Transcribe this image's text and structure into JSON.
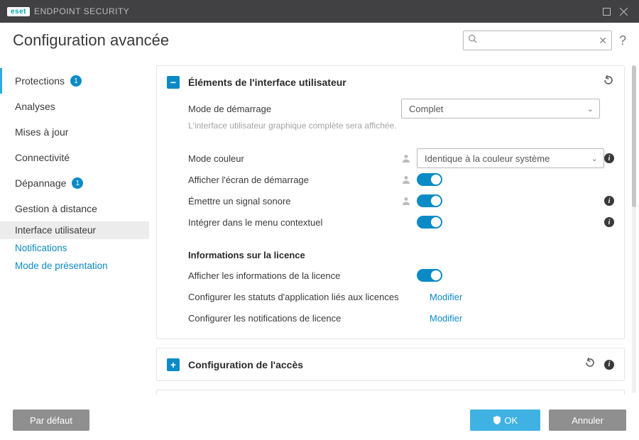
{
  "titlebar": {
    "brand": "eset",
    "product": "ENDPOINT SECURITY"
  },
  "header": {
    "title": "Configuration avancée",
    "search_placeholder": ""
  },
  "sidebar": {
    "items": [
      {
        "label": "Protections",
        "badge": "1"
      },
      {
        "label": "Analyses"
      },
      {
        "label": "Mises à jour"
      },
      {
        "label": "Connectivité"
      },
      {
        "label": "Dépannage",
        "badge": "1"
      },
      {
        "label": "Gestion à distance"
      }
    ],
    "sub": [
      {
        "label": "Interface utilisateur"
      },
      {
        "label": "Notifications"
      },
      {
        "label": "Mode de présentation"
      }
    ]
  },
  "panel1": {
    "title": "Éléments de l'interface utilisateur",
    "start_mode_label": "Mode de démarrage",
    "start_mode_value": "Complet",
    "start_mode_hint": "L'interface utilisateur graphique complète sera affichée.",
    "color_mode_label": "Mode couleur",
    "color_mode_value": "Identique à la couleur système",
    "splash_label": "Afficher l'écran de démarrage",
    "beep_label": "Émettre un signal sonore",
    "context_label": "Intégrer dans le menu contextuel",
    "license_head": "Informations sur la licence",
    "show_license_label": "Afficher les informations de la licence",
    "config_status_label": "Configurer les statuts d'application liés aux licences",
    "config_notif_label": "Configurer les notifications de licence",
    "modify": "Modifier"
  },
  "panel2": {
    "title": "Configuration de l'accès"
  },
  "footer": {
    "default": "Par défaut",
    "ok": "OK",
    "cancel": "Annuler"
  }
}
